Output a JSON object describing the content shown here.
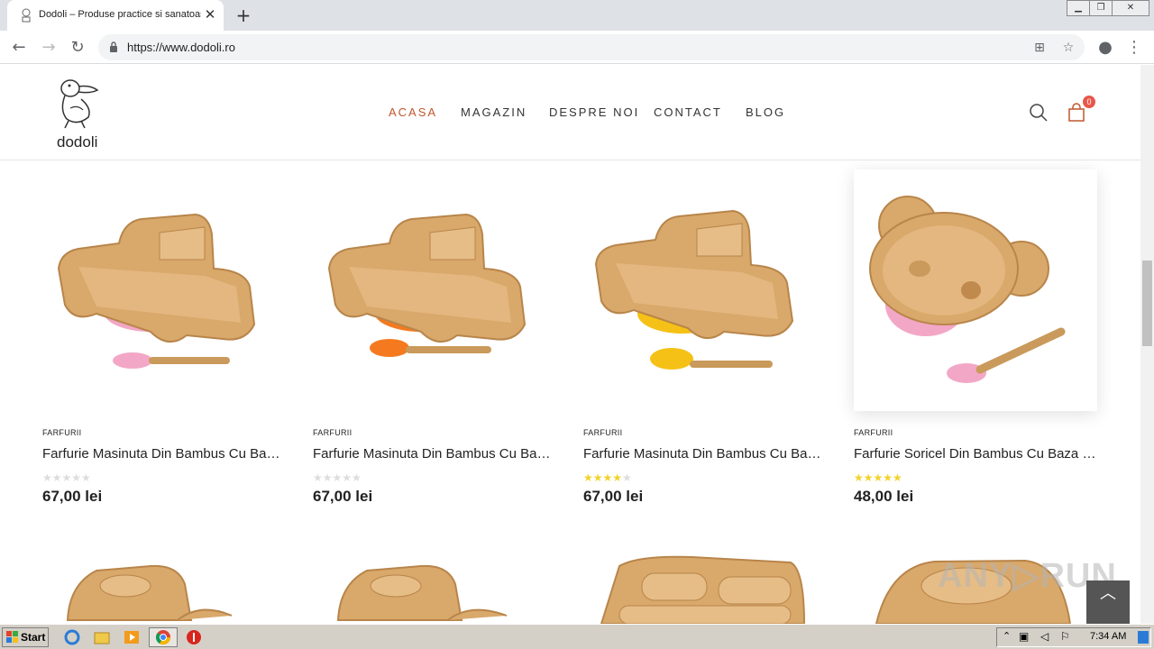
{
  "browser": {
    "tab_title": "Dodoli – Produse practice si sanatoase",
    "tab_close": "✕",
    "new_tab": "+",
    "url": "https://www.dodoli.ro",
    "win_minimize": "▁",
    "win_restore": "❐",
    "win_close": "✕"
  },
  "site": {
    "logo_text": "dodoli",
    "nav": [
      "ACASA",
      "MAGAZIN",
      "DESPRE NOI",
      "CONTACT",
      "BLOG"
    ],
    "active_nav": "ACASA",
    "cart_count": "0",
    "accent_color": "#c0562e"
  },
  "products": [
    {
      "category": "FARFURII",
      "name": "Farfurie Masinuta Din Bambus Cu Baza Din Silicon – Roz",
      "rating": 0,
      "price": "67,00 lei"
    },
    {
      "category": "FARFURII",
      "name": "Farfurie Masinuta Din Bambus Cu Baza Din Silicon – Portocaliu",
      "rating": 0,
      "price": "67,00 lei"
    },
    {
      "category": "FARFURII",
      "name": "Farfurie Masinuta Din Bambus Cu Baza Din Silicon – Galben",
      "rating": 4,
      "price": "67,00 lei"
    },
    {
      "category": "FARFURII",
      "name": "Farfurie Soricel Din Bambus Cu Baza Din Silicon – Roz",
      "rating": 5,
      "price": "48,00 lei"
    }
  ],
  "watermark": "ANY▷RUN",
  "scroll_top_icon": "chevron-up-icon",
  "taskbar": {
    "start_label": "Start",
    "clock": "7:34 AM"
  }
}
